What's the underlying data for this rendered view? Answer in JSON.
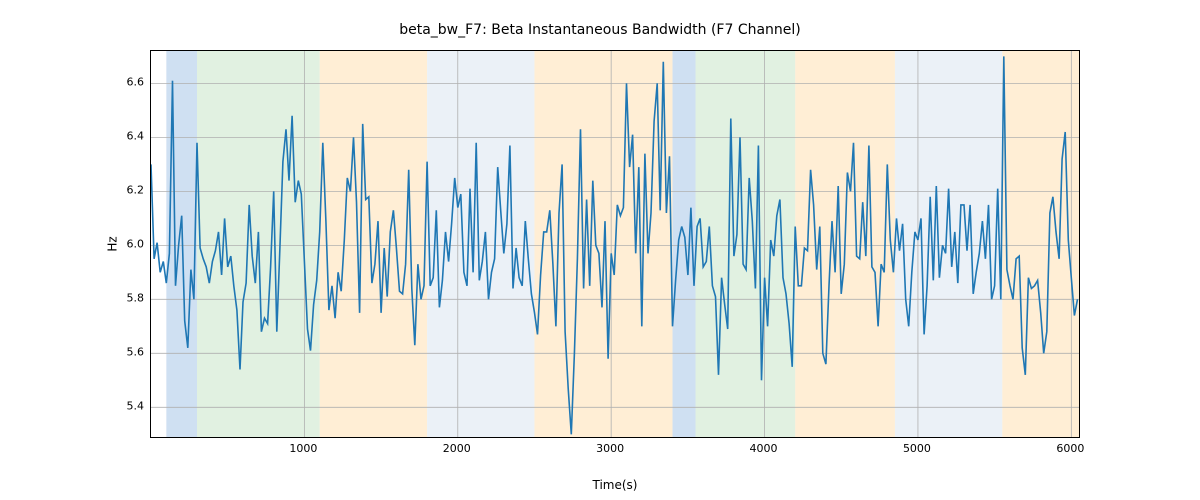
{
  "chart_data": {
    "type": "line",
    "title": "beta_bw_F7: Beta Instantaneous Bandwidth (F7 Channel)",
    "xlabel": "Time(s)",
    "ylabel": "Hz",
    "xlim": [
      0,
      6050
    ],
    "ylim": [
      5.29,
      6.72
    ],
    "xticks": [
      1000,
      2000,
      3000,
      4000,
      5000,
      6000
    ],
    "yticks": [
      5.4,
      5.6,
      5.8,
      6.0,
      6.2,
      6.4,
      6.6
    ],
    "background_bands": [
      {
        "x0": 100,
        "x1": 300,
        "color": "#a7c7e7"
      },
      {
        "x0": 300,
        "x1": 1100,
        "color": "#c8e6c9"
      },
      {
        "x0": 1100,
        "x1": 1800,
        "color": "#ffe0b2"
      },
      {
        "x0": 1800,
        "x1": 2500,
        "color": "#dbe5f1"
      },
      {
        "x0": 2500,
        "x1": 3400,
        "color": "#ffe0b2"
      },
      {
        "x0": 3400,
        "x1": 3550,
        "color": "#a7c7e7"
      },
      {
        "x0": 3550,
        "x1": 4200,
        "color": "#c8e6c9"
      },
      {
        "x0": 4200,
        "x1": 4850,
        "color": "#ffe0b2"
      },
      {
        "x0": 4850,
        "x1": 5550,
        "color": "#dbe5f1"
      },
      {
        "x0": 5550,
        "x1": 6050,
        "color": "#ffe0b2"
      }
    ],
    "series": [
      {
        "name": "beta_bw_F7",
        "color": "#1f77b4",
        "x_step": 20,
        "values": [
          6.3,
          5.95,
          6.01,
          5.9,
          5.94,
          5.86,
          5.97,
          6.61,
          5.85,
          6.0,
          6.11,
          5.72,
          5.62,
          5.91,
          5.8,
          6.38,
          5.99,
          5.95,
          5.92,
          5.86,
          5.94,
          5.98,
          6.05,
          5.89,
          6.1,
          5.92,
          5.96,
          5.85,
          5.76,
          5.54,
          5.79,
          5.86,
          6.15,
          5.96,
          5.86,
          6.05,
          5.68,
          5.73,
          5.71,
          5.92,
          6.2,
          5.68,
          5.98,
          6.31,
          6.43,
          6.24,
          6.48,
          6.16,
          6.24,
          6.19,
          5.94,
          5.69,
          5.61,
          5.78,
          5.87,
          6.05,
          6.38,
          6.09,
          5.76,
          5.85,
          5.73,
          5.9,
          5.83,
          6.02,
          6.25,
          6.2,
          6.4,
          6.16,
          5.75,
          6.45,
          6.17,
          6.18,
          5.86,
          5.93,
          6.09,
          5.75,
          5.99,
          5.81,
          6.05,
          6.13,
          5.99,
          5.83,
          5.82,
          5.93,
          6.28,
          5.84,
          5.63,
          5.93,
          5.8,
          5.85,
          6.31,
          5.85,
          5.88,
          6.13,
          5.77,
          5.87,
          6.05,
          5.94,
          6.08,
          6.25,
          6.14,
          6.19,
          5.9,
          5.85,
          6.21,
          5.9,
          6.38,
          5.87,
          5.94,
          6.05,
          5.8,
          5.9,
          5.95,
          6.29,
          6.13,
          5.97,
          6.08,
          6.37,
          5.84,
          5.99,
          5.88,
          5.85,
          6.09,
          5.95,
          5.82,
          5.75,
          5.67,
          5.89,
          6.05,
          6.05,
          6.13,
          5.93,
          5.7,
          6.12,
          6.3,
          5.68,
          5.47,
          5.3,
          5.6,
          5.95,
          6.43,
          5.84,
          6.17,
          5.85,
          6.24,
          6.0,
          5.97,
          5.77,
          6.09,
          5.58,
          5.97,
          5.89,
          6.15,
          6.11,
          6.14,
          6.6,
          6.29,
          6.41,
          5.97,
          6.29,
          5.7,
          6.34,
          5.97,
          6.12,
          6.46,
          6.6,
          6.13,
          6.68,
          6.12,
          6.33,
          5.7,
          5.87,
          6.02,
          6.07,
          6.03,
          5.89,
          6.14,
          5.85,
          6.07,
          6.1,
          5.92,
          5.94,
          6.07,
          5.85,
          5.81,
          5.52,
          5.88,
          5.78,
          5.69,
          6.47,
          5.96,
          6.04,
          6.4,
          5.93,
          5.91,
          6.25,
          6.09,
          5.84,
          6.37,
          5.5,
          5.88,
          5.7,
          6.02,
          5.96,
          6.11,
          6.17,
          5.88,
          5.82,
          5.71,
          5.55,
          6.07,
          5.85,
          5.85,
          5.99,
          5.98,
          6.28,
          6.15,
          5.91,
          6.07,
          5.6,
          5.56,
          5.85,
          6.09,
          5.9,
          6.22,
          5.82,
          5.93,
          6.27,
          6.2,
          6.38,
          5.96,
          5.95,
          6.16,
          5.96,
          6.37,
          5.92,
          5.9,
          5.7,
          5.93,
          5.9,
          6.3,
          6.02,
          5.9,
          6.1,
          5.98,
          6.08,
          5.8,
          5.7,
          5.9,
          6.05,
          6.02,
          6.1,
          5.67,
          5.85,
          6.18,
          5.87,
          6.22,
          5.88,
          6.0,
          5.97,
          6.21,
          5.92,
          6.05,
          5.86,
          6.15,
          6.15,
          5.98,
          6.15,
          5.82,
          5.9,
          5.97,
          6.09,
          5.95,
          6.15,
          5.8,
          5.85,
          6.21,
          5.8,
          6.7,
          5.91,
          5.85,
          5.8,
          5.95,
          5.96,
          5.62,
          5.52,
          5.88,
          5.84,
          5.85,
          5.87,
          5.75,
          5.6,
          5.68,
          6.12,
          6.18,
          6.05,
          5.95,
          6.32,
          6.42,
          6.02,
          5.88,
          5.74,
          5.8
        ]
      }
    ]
  }
}
